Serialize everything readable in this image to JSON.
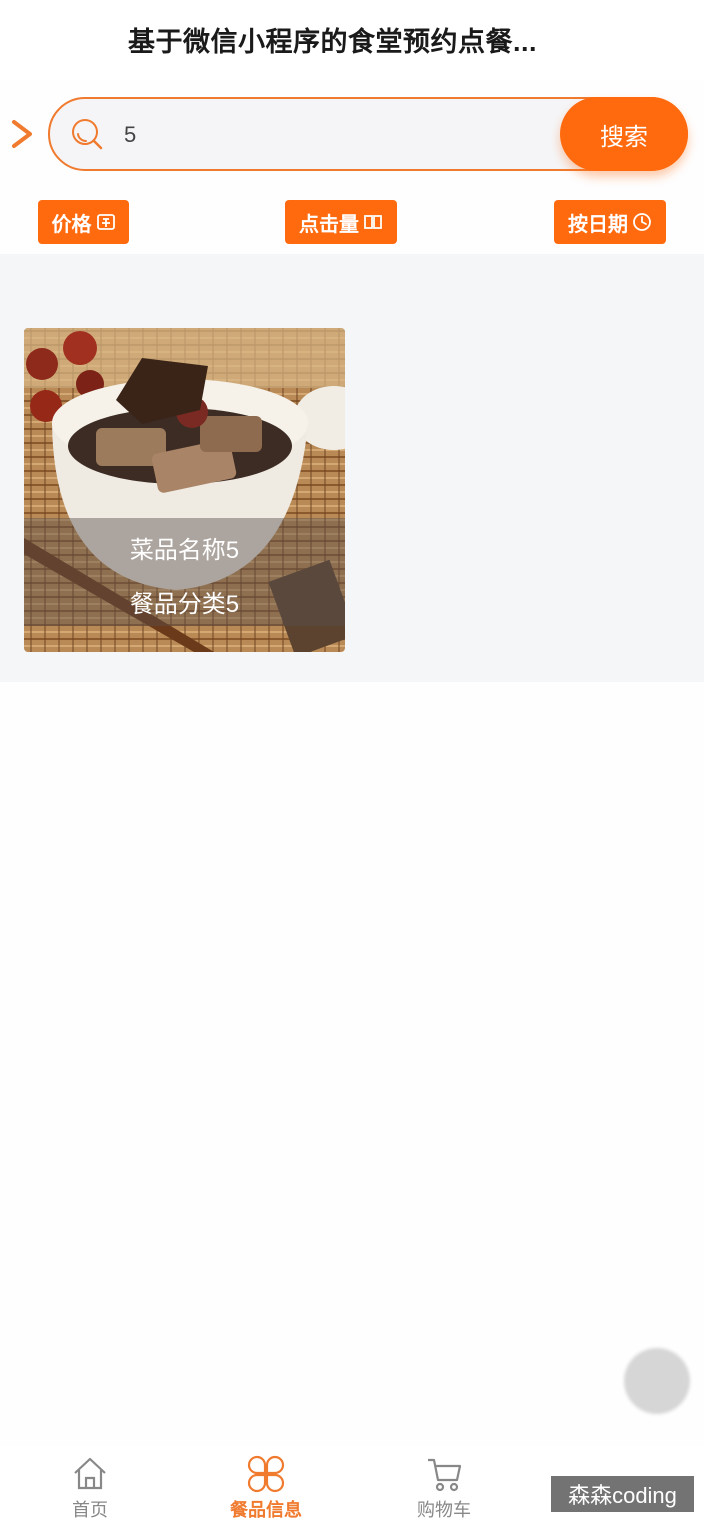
{
  "header": {
    "title": "基于微信小程序的食堂预约点餐..."
  },
  "search": {
    "value": "5",
    "button_label": "搜索"
  },
  "sort": [
    {
      "label": "价格"
    },
    {
      "label": "点击量"
    },
    {
      "label": "按日期"
    }
  ],
  "dishes": [
    {
      "name": "菜品名称5",
      "category": "餐品分类5"
    }
  ],
  "tabbar": {
    "items": [
      {
        "label": "首页",
        "icon": "home-icon"
      },
      {
        "label": "餐品信息",
        "icon": "clover-grid-icon",
        "active": true
      },
      {
        "label": "购物车",
        "icon": "cart-icon"
      }
    ]
  },
  "watermark": "森森coding",
  "colors": {
    "accent": "#ff6a0e",
    "border": "#f07a2e",
    "background": "#f5f6f8"
  }
}
